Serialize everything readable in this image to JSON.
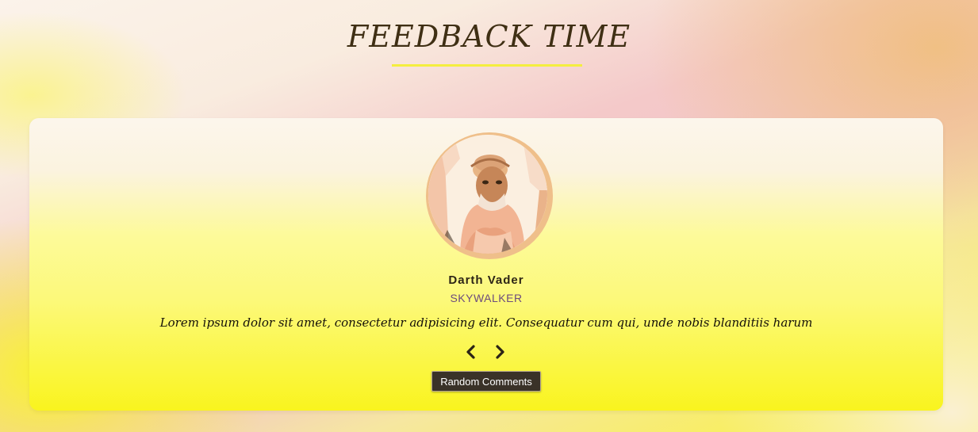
{
  "header": {
    "title": "FEEDBACK TIME"
  },
  "testimonial": {
    "name": "Darth Vader",
    "job": "SKYWALKER",
    "text": "Lorem ipsum dolor sit amet, consectetur adipisicing elit. Consequatur cum qui, unde nobis blanditiis harum",
    "avatar_alt": "avatar"
  },
  "controls": {
    "prev_icon": "chevron-left-icon",
    "next_icon": "chevron-right-icon",
    "random_label": "Random Comments"
  },
  "colors": {
    "underline": "#f4ee3f",
    "avatar_ring": "#efbf8a",
    "button_bg": "#3a3228",
    "job_text": "#6d4c7d"
  }
}
